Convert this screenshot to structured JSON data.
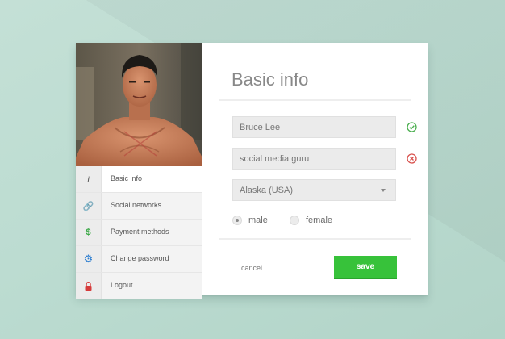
{
  "profile": {
    "title": "Basic info",
    "name_value": "Bruce Lee",
    "bio_value": "social media guru",
    "location_value": "Alaska (USA)",
    "gender_options": [
      "male",
      "female"
    ],
    "gender_selected": "male",
    "name_status": "valid",
    "bio_status": "invalid"
  },
  "sidebar": {
    "items": [
      {
        "label": "Basic info",
        "icon": "info-icon",
        "glyph": "i",
        "color": "#555555",
        "active": true
      },
      {
        "label": "Social networks",
        "icon": "link-icon",
        "glyph": "🔗",
        "color": "#e39b3d",
        "active": false
      },
      {
        "label": "Payment methods",
        "icon": "dollar-icon",
        "glyph": "$",
        "color": "#3aa846",
        "active": false
      },
      {
        "label": "Change password",
        "icon": "gear-icon",
        "glyph": "⚙",
        "color": "#2f7fd0",
        "active": false
      },
      {
        "label": "Logout",
        "icon": "lock-icon",
        "glyph": "🔒",
        "color": "#d63b3b",
        "active": false
      }
    ]
  },
  "actions": {
    "cancel_label": "cancel",
    "save_label": "save"
  },
  "colors": {
    "accent": "#37c23a",
    "valid": "#4caf50",
    "invalid": "#d9534f",
    "background": "#b7d8cd"
  }
}
